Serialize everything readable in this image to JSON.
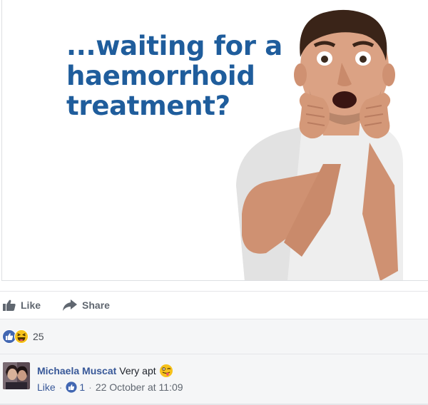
{
  "ad": {
    "headline_lines": [
      "...waiting for a",
      "haemorrhoid",
      "treatment?"
    ]
  },
  "actions": {
    "like_label": "Like",
    "share_label": "Share"
  },
  "reactions": {
    "count": "25",
    "types": [
      "like-icon",
      "haha-icon"
    ]
  },
  "comment": {
    "author": "Michaela Muscat",
    "text": "Very apt",
    "emoji": "winking-tongue-emoji",
    "like_label": "Like",
    "separator": "·",
    "like_count": "1",
    "timestamp": "22 October at 11:09"
  },
  "colors": {
    "headline_blue": "#1f5d9c",
    "link_blue": "#385898",
    "facebook_blue": "#4267b2",
    "muted_gray": "#606770",
    "panel_bg": "#f5f6f7"
  }
}
